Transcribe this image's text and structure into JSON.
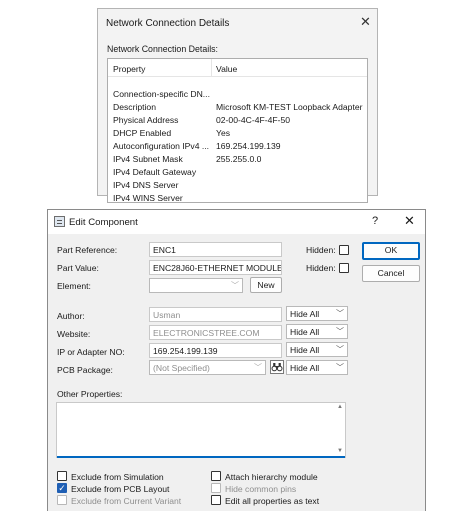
{
  "network_dialog": {
    "title": "Network Connection Details",
    "close_glyph": "✕",
    "subtitle": "Network Connection Details:",
    "columns": [
      "Property",
      "Value"
    ],
    "rows": [
      {
        "property": "Connection-specific DN...",
        "value": ""
      },
      {
        "property": "Description",
        "value": "Microsoft KM-TEST Loopback Adapter"
      },
      {
        "property": "Physical Address",
        "value": "02-00-4C-4F-4F-50"
      },
      {
        "property": "DHCP Enabled",
        "value": "Yes"
      },
      {
        "property": "Autoconfiguration IPv4 ...",
        "value": "169.254.199.139"
      },
      {
        "property": "IPv4 Subnet Mask",
        "value": "255.255.0.0"
      },
      {
        "property": "IPv4 Default Gateway",
        "value": ""
      },
      {
        "property": "IPv4 DNS Server",
        "value": ""
      },
      {
        "property": "IPv4 WINS Server",
        "value": ""
      }
    ]
  },
  "edit_dialog": {
    "title": "Edit Component",
    "help_glyph": "?",
    "close_glyph": "✕",
    "part_reference": {
      "label": "Part Reference:",
      "value": "ENC1",
      "hidden_label": "Hidden:"
    },
    "part_value": {
      "label": "Part Value:",
      "value": "ENC28J60-ETHERNET MODULE",
      "hidden_label": "Hidden:"
    },
    "element": {
      "label": "Element:",
      "value": "",
      "new_button": "New"
    },
    "author": {
      "label": "Author:",
      "value": "Usman",
      "visibility": "Hide All"
    },
    "website": {
      "label": "Website:",
      "value": "ELECTRONICSTREE.COM",
      "visibility": "Hide All"
    },
    "ip": {
      "label": "IP or Adapter NO:",
      "value": "169.254.199.139",
      "visibility": "Hide All"
    },
    "pcb": {
      "label": "PCB Package:",
      "value": "(Not Specified)",
      "visibility": "Hide All"
    },
    "other_properties_label": "Other Properties:",
    "ok_button": "OK",
    "cancel_button": "Cancel",
    "checkboxes": {
      "exclude_simulation": {
        "label": "Exclude from Simulation",
        "checked": false,
        "enabled": true
      },
      "exclude_pcb": {
        "label": "Exclude from PCB Layout",
        "checked": true,
        "enabled": true
      },
      "exclude_variant": {
        "label": "Exclude from Current Variant",
        "checked": false,
        "enabled": false
      },
      "attach_hierarchy": {
        "label": "Attach hierarchy module",
        "checked": false,
        "enabled": true
      },
      "hide_pins": {
        "label": "Hide common pins",
        "checked": false,
        "enabled": false
      },
      "edit_all_text": {
        "label": "Edit all properties as text",
        "checked": false,
        "enabled": true
      }
    },
    "icons": {
      "app": "component-edit-icon",
      "browse": "binoculars-icon"
    },
    "accent_color": "#0067c0"
  }
}
